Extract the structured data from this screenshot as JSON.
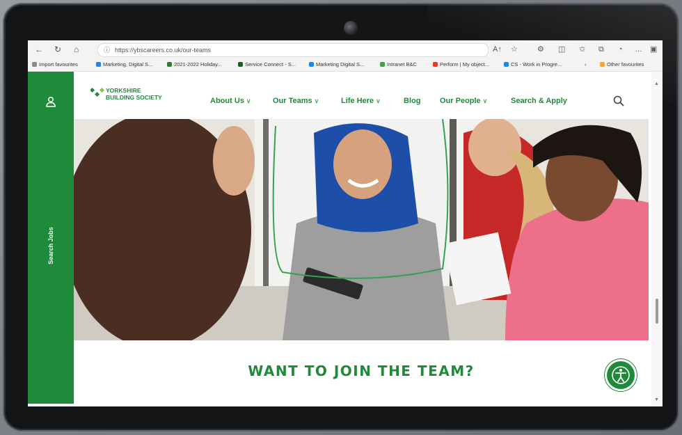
{
  "browser": {
    "url": "https://ybscareers.co.uk/our-teams",
    "address_ico": "ⓘ",
    "nav_icons": {
      "back": "←",
      "refresh": "↻",
      "home": "⌂"
    },
    "toolbar_icons": {
      "read_aloud": "A↑",
      "favorite": "☆",
      "extensions": "⚙",
      "split": "◫",
      "favorites": "✩",
      "collections": "⧉",
      "profile": "◔",
      "more": "…",
      "sidebar": "▣"
    },
    "bookmarks": [
      {
        "label": "Import favourites",
        "color": "#8a8a8a"
      },
      {
        "label": "Marketing, Digital S...",
        "color": "#1e88e5"
      },
      {
        "label": "2021-2022 Holiday...",
        "color": "#2e7d32"
      },
      {
        "label": "Service Connect - S...",
        "color": "#1b5e20"
      },
      {
        "label": "Marketing Digital S...",
        "color": "#1e88e5"
      },
      {
        "label": "Intranet B&C",
        "color": "#43a047"
      },
      {
        "label": "Perform | My object...",
        "color": "#e53935"
      },
      {
        "label": "CS - Work in Progre...",
        "color": "#1e88e5"
      }
    ],
    "bookmarks_more": "›",
    "other_favourites": {
      "label": "Other favourites",
      "color": "#f9a825"
    }
  },
  "site": {
    "logo_line1": "YORKSHIRE",
    "logo_line2": "BUILDING SOCIETY",
    "menu": [
      {
        "label": "About Us",
        "dropdown": "∨"
      },
      {
        "label": "Our Teams",
        "dropdown": "∨"
      },
      {
        "label": "Life Here",
        "dropdown": "∨"
      },
      {
        "label": "Blog",
        "dropdown": ""
      },
      {
        "label": "Our People",
        "dropdown": "∨"
      },
      {
        "label": "Search & Apply",
        "dropdown": ""
      }
    ],
    "side_tab_label": "Search Jobs",
    "cta_title": "WANT TO JOIN THE TEAM?",
    "brand_green": "#1f8a3a"
  },
  "scrollbar": {
    "up": "▲",
    "down": "▼"
  }
}
